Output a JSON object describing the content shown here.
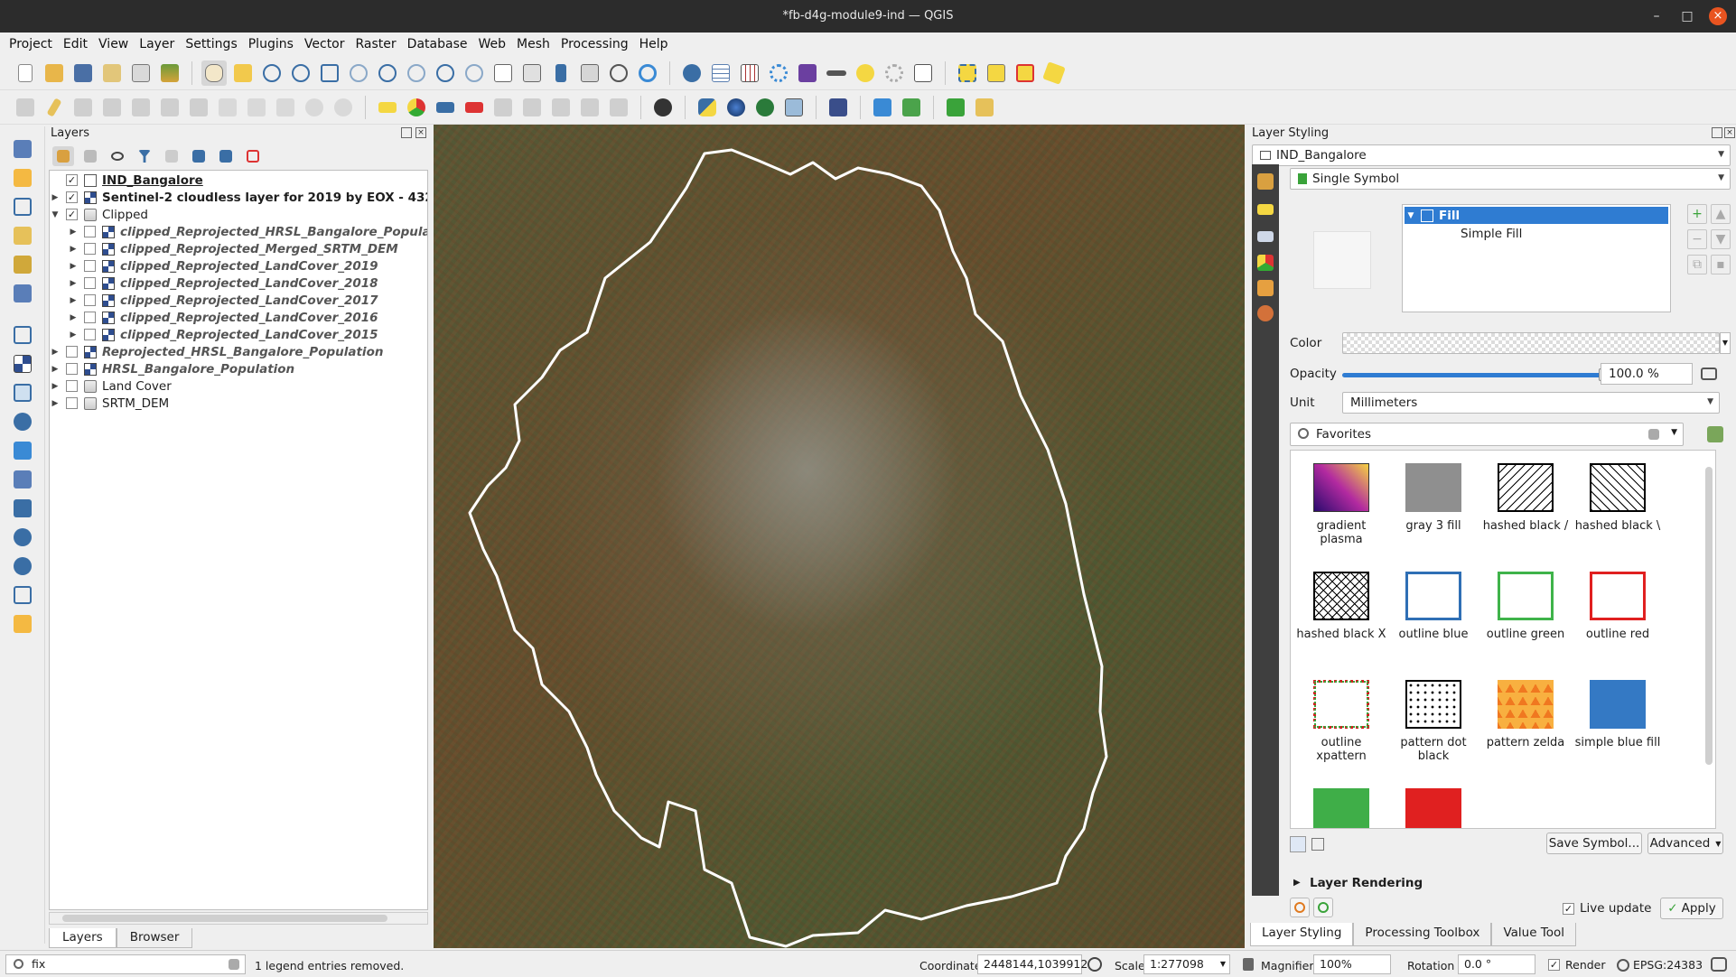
{
  "window": {
    "title": "*fb-d4g-module9-ind — QGIS",
    "minimize": "–",
    "maximize": "□",
    "close": "×"
  },
  "menu": [
    "Project",
    "Edit",
    "View",
    "Layer",
    "Settings",
    "Plugins",
    "Vector",
    "Raster",
    "Database",
    "Web",
    "Mesh",
    "Processing",
    "Help"
  ],
  "layers_panel": {
    "title": "Layers",
    "tree": [
      {
        "label": "IND_Bangalore",
        "checked": "✓"
      },
      {
        "label": "Sentinel-2 cloudless layer for 2019 by EOX - 432",
        "checked": "✓"
      },
      {
        "label": "Clipped",
        "checked": "✓"
      },
      {
        "label": "clipped_Reprojected_HRSL_Bangalore_Popula"
      },
      {
        "label": "clipped_Reprojected_Merged_SRTM_DEM"
      },
      {
        "label": "clipped_Reprojected_LandCover_2019"
      },
      {
        "label": "clipped_Reprojected_LandCover_2018"
      },
      {
        "label": "clipped_Reprojected_LandCover_2017"
      },
      {
        "label": "clipped_Reprojected_LandCover_2016"
      },
      {
        "label": "clipped_Reprojected_LandCover_2015"
      },
      {
        "label": "Reprojected_HRSL_Bangalore_Population"
      },
      {
        "label": "HRSL_Bangalore_Population"
      },
      {
        "label": "Land Cover"
      },
      {
        "label": "SRTM_DEM"
      }
    ],
    "tabs": [
      "Layers",
      "Browser"
    ]
  },
  "styling": {
    "title": "Layer Styling",
    "layer": "IND_Bangalore",
    "renderer": "Single Symbol",
    "symbol_tree": [
      "Fill",
      "Simple Fill"
    ],
    "color_label": "Color",
    "opacity_label": "Opacity",
    "opacity_value": "100.0 %",
    "opacity_fraction": 1.0,
    "unit_label": "Unit",
    "unit_value": "Millimeters",
    "search_value": "Favorites",
    "symbols": [
      {
        "label": "gradient plasma"
      },
      {
        "label": "gray 3 fill"
      },
      {
        "label": "hashed black /"
      },
      {
        "label": "hashed black \\"
      },
      {
        "label": "hashed black X"
      },
      {
        "label": "outline blue"
      },
      {
        "label": "outline green"
      },
      {
        "label": "outline red"
      },
      {
        "label": "outline xpattern"
      },
      {
        "label": "pattern dot black"
      },
      {
        "label": "pattern zelda"
      },
      {
        "label": "simple blue fill"
      }
    ],
    "save_symbol": "Save Symbol...",
    "advanced": "Advanced",
    "layer_rendering": "Layer Rendering",
    "live_update": "Live update",
    "apply": "Apply",
    "tabs": [
      "Layer Styling",
      "Processing Toolbox",
      "Value Tool"
    ]
  },
  "status": {
    "locator_value": "fix",
    "message": "1 legend entries removed.",
    "coordinate_label": "Coordinate",
    "coordinate_value": "2448144,1039912",
    "scale_label": "Scale",
    "scale_value": "1:277098",
    "magnifier_label": "Magnifier",
    "magnifier_value": "100%",
    "rotation_label": "Rotation",
    "rotation_value": "0.0 °",
    "render_label": "Render",
    "crs": "EPSG:24383"
  }
}
